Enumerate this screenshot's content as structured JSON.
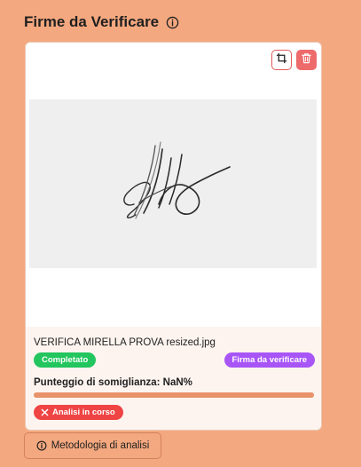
{
  "section": {
    "title": "Firme da Verificare",
    "info_icon": "info-circle-icon"
  },
  "card": {
    "toolbar": {
      "crop_icon": "crop-icon",
      "delete_icon": "trash-icon"
    },
    "image_description": "handwritten signature",
    "filename": "VERIFICA MIRELLA PROVA resized.jpg",
    "status_badge": "Completato",
    "type_badge": "Firma da verificare",
    "score_label": "Punteggio di somiglianza: NaN%",
    "score_progress": 1.0,
    "analysis_status": "Analisi in corso",
    "analysis_status_icon": "x-icon"
  },
  "footer": {
    "method_button": "Metodologia di analisi",
    "method_icon": "info-circle-icon"
  },
  "colors": {
    "background": "#f4a87f",
    "card": "#fdf4ef",
    "success": "#22c55e",
    "accent_purple": "#a855f7",
    "danger": "#ef4444"
  }
}
